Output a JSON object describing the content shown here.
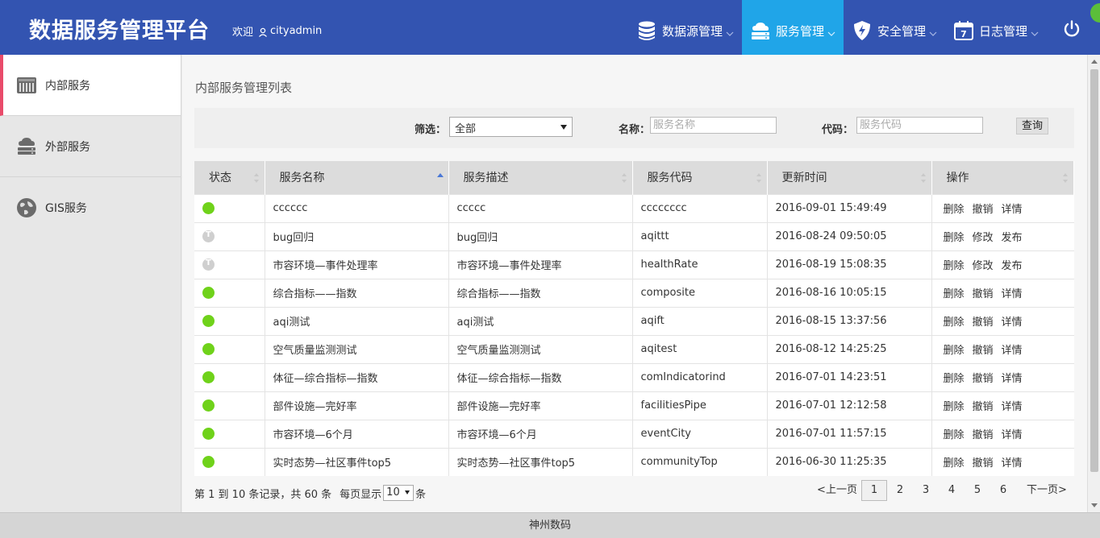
{
  "header": {
    "app_title": "数据服务管理平台",
    "welcome_text": "欢迎",
    "username": "cityadmin",
    "nav": [
      {
        "label": "数据源管理",
        "icon": "database-icon",
        "active": false
      },
      {
        "label": "服务管理",
        "icon": "cloud-server-icon",
        "active": true
      },
      {
        "label": "安全管理",
        "icon": "shield-bolt-icon",
        "active": false
      },
      {
        "label": "日志管理",
        "icon": "calendar-icon",
        "active": false
      }
    ],
    "accent_color": "#3354b1",
    "active_color": "#20a5e8"
  },
  "sidebar": {
    "items": [
      {
        "label": "内部服务",
        "icon": "server-rack-icon",
        "active": true
      },
      {
        "label": "外部服务",
        "icon": "cloud-server-icon",
        "active": false
      },
      {
        "label": "GIS服务",
        "icon": "globe-icon",
        "active": false
      }
    ]
  },
  "main": {
    "page_title": "内部服务管理列表",
    "filter": {
      "filter_label": "筛选：",
      "filter_value": "全部",
      "name_label": "名称：",
      "name_placeholder": "服务名称",
      "code_label": "代码：",
      "code_placeholder": "服务代码",
      "query_label": "查询"
    },
    "table": {
      "headers": [
        "状态",
        "服务名称",
        "服务描述",
        "服务代码",
        "更新时间",
        "操作"
      ],
      "rows": [
        {
          "status": "published",
          "name": "cccccc",
          "desc": "ccccc",
          "code": "cccccccc",
          "time": "2016-09-01 15:49:49",
          "ops": [
            "删除",
            "撤销",
            "详情"
          ]
        },
        {
          "status": "draft",
          "name": "bug回归",
          "desc": "bug回归",
          "code": "aqittt",
          "time": "2016-08-24 09:50:05",
          "ops": [
            "删除",
            "修改",
            "发布"
          ]
        },
        {
          "status": "draft",
          "name": "市容环境—事件处理率",
          "desc": "市容环境—事件处理率",
          "code": "healthRate",
          "time": "2016-08-19 15:08:35",
          "ops": [
            "删除",
            "修改",
            "发布"
          ]
        },
        {
          "status": "published",
          "name": "综合指标——指数",
          "desc": "综合指标——指数",
          "code": "composite",
          "time": "2016-08-16 10:05:15",
          "ops": [
            "删除",
            "撤销",
            "详情"
          ]
        },
        {
          "status": "published",
          "name": "aqi测试",
          "desc": "aqi测试",
          "code": "aqift",
          "time": "2016-08-15 13:37:56",
          "ops": [
            "删除",
            "撤销",
            "详情"
          ]
        },
        {
          "status": "published",
          "name": "空气质量监测测试",
          "desc": "空气质量监测测试",
          "code": "aqitest",
          "time": "2016-08-12 14:25:25",
          "ops": [
            "删除",
            "撤销",
            "详情"
          ]
        },
        {
          "status": "published",
          "name": "体征—综合指标—指数",
          "desc": "体征—综合指标—指数",
          "code": "comIndicatorind",
          "time": "2016-07-01 14:23:51",
          "ops": [
            "删除",
            "撤销",
            "详情"
          ]
        },
        {
          "status": "published",
          "name": "部件设施—完好率",
          "desc": "部件设施—完好率",
          "code": "facilitiesPipe",
          "time": "2016-07-01 12:12:58",
          "ops": [
            "删除",
            "撤销",
            "详情"
          ]
        },
        {
          "status": "published",
          "name": "市容环境—6个月",
          "desc": "市容环境—6个月",
          "code": "eventCity",
          "time": "2016-07-01 11:57:15",
          "ops": [
            "删除",
            "撤销",
            "详情"
          ]
        },
        {
          "status": "published",
          "name": "实时态势—社区事件top5",
          "desc": "实时态势—社区事件top5",
          "code": "communityTop",
          "time": "2016-06-30 11:25:35",
          "ops": [
            "删除",
            "撤销",
            "详情"
          ]
        }
      ]
    },
    "pagination": {
      "info_prefix": "第 1 到 10 条记录，共 60 条",
      "per_page_label": "每页显示",
      "per_page_value": "10",
      "per_page_suffix": "条",
      "prev": "<上一页",
      "pages": [
        "1",
        "2",
        "3",
        "4",
        "5",
        "6"
      ],
      "current": "1",
      "next": "下一页>"
    }
  },
  "footer": {
    "text": "神州数码"
  }
}
